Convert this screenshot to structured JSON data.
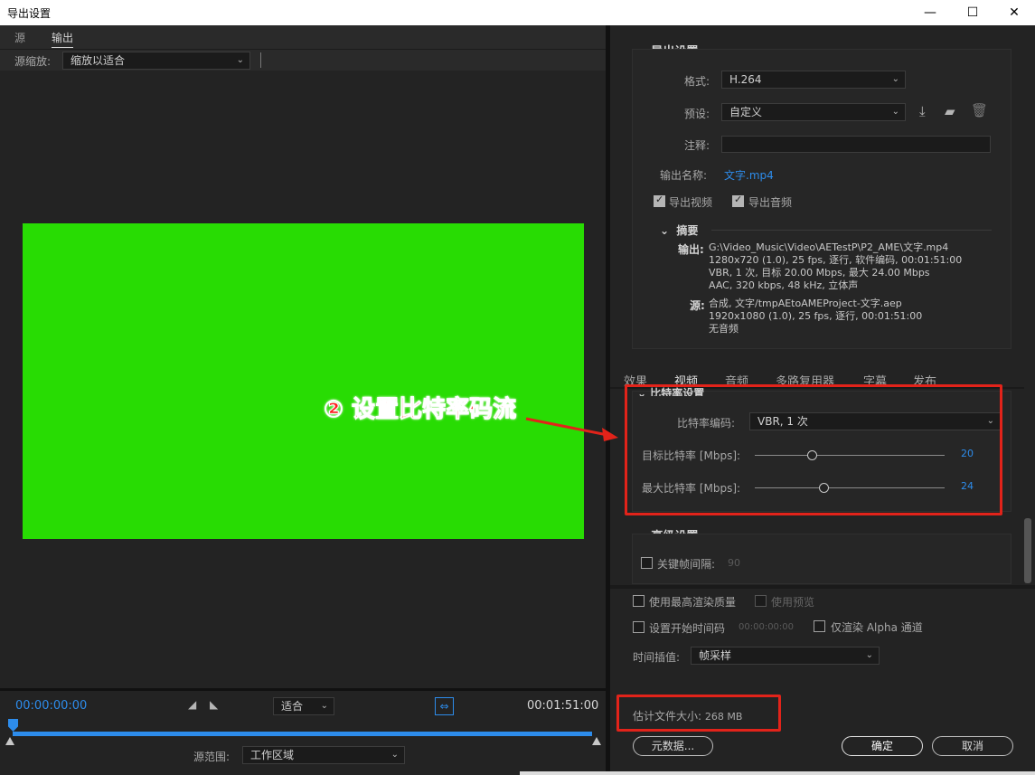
{
  "window": {
    "title": "导出设置",
    "min": "—",
    "max": "☐",
    "close": "✕"
  },
  "left": {
    "tabs": [
      "源",
      "输出"
    ],
    "zoom_label": "源缩放:",
    "zoom_value": "缩放以适合",
    "timecode_start": "00:00:00:00",
    "timecode_end": "00:01:51:00",
    "fit_value": "适合",
    "range_label": "源范围:",
    "range_value": "工作区域",
    "annotation": "② 设置比特率码流"
  },
  "right": {
    "export_settings_header": "导出设置",
    "format_label": "格式:",
    "format_value": "H.264",
    "preset_label": "预设:",
    "preset_value": "自定义",
    "comment_label": "注释:",
    "output_name_label": "输出名称:",
    "output_name_value": "文字.mp4",
    "export_video": "导出视频",
    "export_audio": "导出音频",
    "summary_header": "摘要",
    "output_label": "输出:",
    "output_lines": [
      "G:\\Video_Music\\Video\\AETestP\\P2_AME\\文字.mp4",
      "1280x720 (1.0), 25 fps, 逐行, 软件编码, 00:01:51:00",
      "VBR, 1 次, 目标 20.00 Mbps, 最大 24.00 Mbps",
      "AAC, 320 kbps, 48 kHz, 立体声"
    ],
    "source_label": "源:",
    "source_lines": [
      "合成, 文字/tmpAEtoAMEProject-文字.aep",
      "1920x1080 (1.0), 25 fps, 逐行, 00:01:51:00",
      "无音频"
    ],
    "tabs": [
      "效果",
      "视频",
      "音频",
      "多路复用器",
      "字幕",
      "发布"
    ],
    "bitrate_header": "比特率设置",
    "bitrate_encoding_label": "比特率编码:",
    "bitrate_encoding_value": "VBR, 1 次",
    "target_label": "目标比特率 [Mbps]:",
    "target_value": "20",
    "max_label": "最大比特率 [Mbps]:",
    "max_value": "24",
    "slider_target_frac": 0.3,
    "slider_max_frac": 0.36,
    "advanced_header": "高级设置",
    "keyframe_label": "关键帧间隔:",
    "keyframe_value": "90",
    "max_render_quality": "使用最高渲染质量",
    "use_preview": "使用预览",
    "set_start_tc": "设置开始时间码",
    "start_tc_value": "00:00:00:00",
    "render_alpha": "仅渲染 Alpha 通道",
    "time_interp_label": "时间插值:",
    "time_interp_value": "帧采样",
    "file_size_label": "估计文件大小:",
    "file_size_value": "268 MB",
    "metadata_button": "元数据...",
    "ok_button": "确定",
    "cancel_button": "取消"
  },
  "colors": {
    "annotation": "#e2231a",
    "accent_blue": "#2d8ceb",
    "preview_green": "#28dc03"
  }
}
